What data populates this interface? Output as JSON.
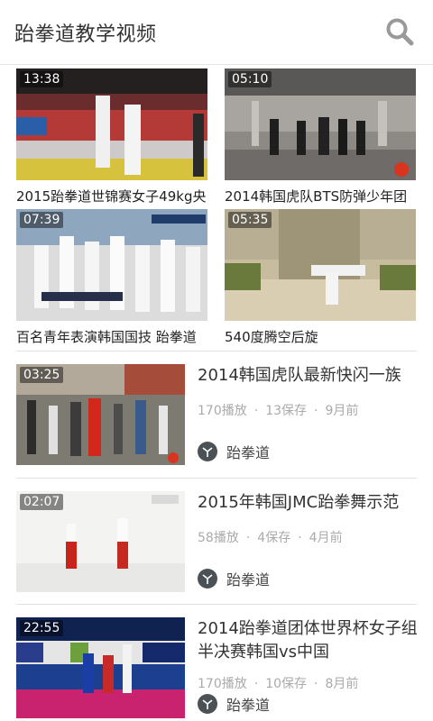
{
  "header": {
    "title": "跆拳道教学视频",
    "search_icon": "search-icon"
  },
  "grid": [
    {
      "duration": "13:38",
      "title": "2015跆拳道世锦赛女子49kg央"
    },
    {
      "duration": "05:10",
      "title": "2014韩国虎队BTS防弹少年团"
    },
    {
      "duration": "07:39",
      "title": "百名青年表演韩国国技 跆拳道"
    },
    {
      "duration": "05:35",
      "title": "540度腾空后旋"
    }
  ],
  "list": [
    {
      "duration": "03:25",
      "title": "2014韩国虎队最新快闪一族",
      "plays": "170播放",
      "saves": "13保存",
      "time": "9月前",
      "tag": "跆拳道"
    },
    {
      "duration": "02:07",
      "title": "2015年韩国JMC跆拳舞示范",
      "plays": "58播放",
      "saves": "4保存",
      "time": "4月前",
      "tag": "跆拳道"
    },
    {
      "duration": "22:55",
      "title": "2014跆拳道团体世界杯女子组半决赛韩国vs中国",
      "plays": "170播放",
      "saves": "10保存",
      "time": "8月前",
      "tag": "跆拳道"
    }
  ],
  "meta_separator": "·",
  "colors": {
    "accent": "#e8001c",
    "meta_gray": "#aaaaaa",
    "icon_dark": "#4b5257"
  }
}
